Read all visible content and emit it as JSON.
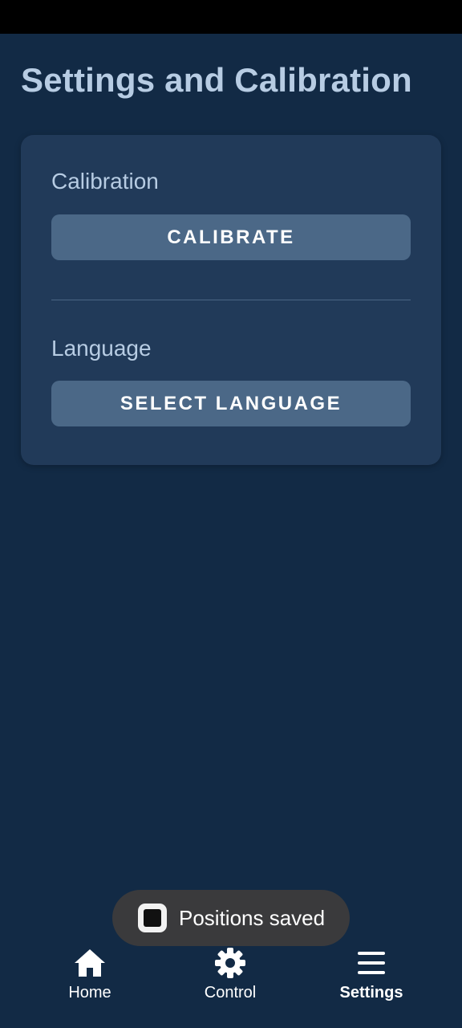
{
  "page": {
    "title": "Settings and Calibration"
  },
  "card": {
    "calibration_label": "Calibration",
    "calibrate_button": "CALIBRATE",
    "language_label": "Language",
    "select_language_button": "SELECT LANGUAGE"
  },
  "toast": {
    "message": "Positions saved",
    "icon": "app-icon"
  },
  "bottom_nav": {
    "items": [
      {
        "label": "Home",
        "icon": "home-icon",
        "active": false
      },
      {
        "label": "Control",
        "icon": "gear-icon",
        "active": false
      },
      {
        "label": "Settings",
        "icon": "menu-icon",
        "active": true
      }
    ]
  },
  "colors": {
    "background": "#122a45",
    "card": "#213a59",
    "button": "#4b6887",
    "title_text": "#b7cce3",
    "toast": "#3a3a3c"
  }
}
